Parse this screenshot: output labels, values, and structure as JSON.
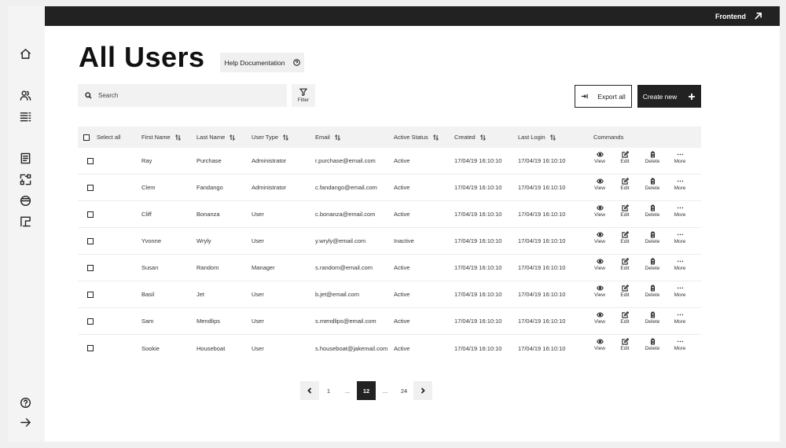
{
  "topbar": {
    "frontend_label": "Frontend"
  },
  "page": {
    "title": "All Users",
    "help_label": "Help Documentation"
  },
  "toolbar": {
    "search_placeholder": "Search",
    "filter_label": "Filter",
    "export_label": "Export all",
    "create_label": "Create new"
  },
  "table": {
    "select_all_label": "Select all",
    "headers": {
      "first_name": "First Name",
      "last_name": "Last Name",
      "user_type": "User Type",
      "email": "Email",
      "active_status": "Active Status",
      "created": "Created",
      "last_login": "Last Login",
      "commands": "Commands"
    },
    "command_labels": {
      "view": "View",
      "edit": "Edit",
      "delete": "Delete",
      "more": "More"
    },
    "rows": [
      {
        "first": "Ray",
        "last": "Purchase",
        "type": "Administrator",
        "email": "r.purchase@email.com",
        "status": "Active",
        "created": "17/04/19 16:10:10",
        "last_login": "17/04/19 16:10:10"
      },
      {
        "first": "Clem",
        "last": "Fandango",
        "type": "Administrator",
        "email": "c.fandango@email.com",
        "status": "Active",
        "created": "17/04/19 16:10:10",
        "last_login": "17/04/19 16:10:10"
      },
      {
        "first": "Cliff",
        "last": "Bonanza",
        "type": "User",
        "email": "c.bonanza@email.com",
        "status": "Active",
        "created": "17/04/19 16:10:10",
        "last_login": "17/04/19 16:10:10"
      },
      {
        "first": "Yvonne",
        "last": "Wryly",
        "type": "User",
        "email": "y.wryly@email.com",
        "status": "Inactive",
        "created": "17/04/19 16:10:10",
        "last_login": "17/04/19 16:10:10"
      },
      {
        "first": "Susan",
        "last": "Random",
        "type": "Manager",
        "email": "s.random@email.com",
        "status": "Active",
        "created": "17/04/19 16:10:10",
        "last_login": "17/04/19 16:10:10"
      },
      {
        "first": "Basil",
        "last": "Jet",
        "type": "User",
        "email": "b.jet@email.com",
        "status": "Active",
        "created": "17/04/19 16:10:10",
        "last_login": "17/04/19 16:10:10"
      },
      {
        "first": "Sam",
        "last": "Mendlips",
        "type": "User",
        "email": "s.mendlips@email.com",
        "status": "Active",
        "created": "17/04/19 16:10:10",
        "last_login": "17/04/19 16:10:10"
      },
      {
        "first": "Sookie",
        "last": "Houseboat",
        "type": "User",
        "email": "s.houseboat@jakemail.com",
        "status": "Active",
        "created": "17/04/19 16:10:10",
        "last_login": "17/04/19 16:10:10"
      }
    ]
  },
  "pagination": {
    "first": "1",
    "ellipsis_left": "...",
    "current": "12",
    "ellipsis_right": "...",
    "last": "24"
  }
}
